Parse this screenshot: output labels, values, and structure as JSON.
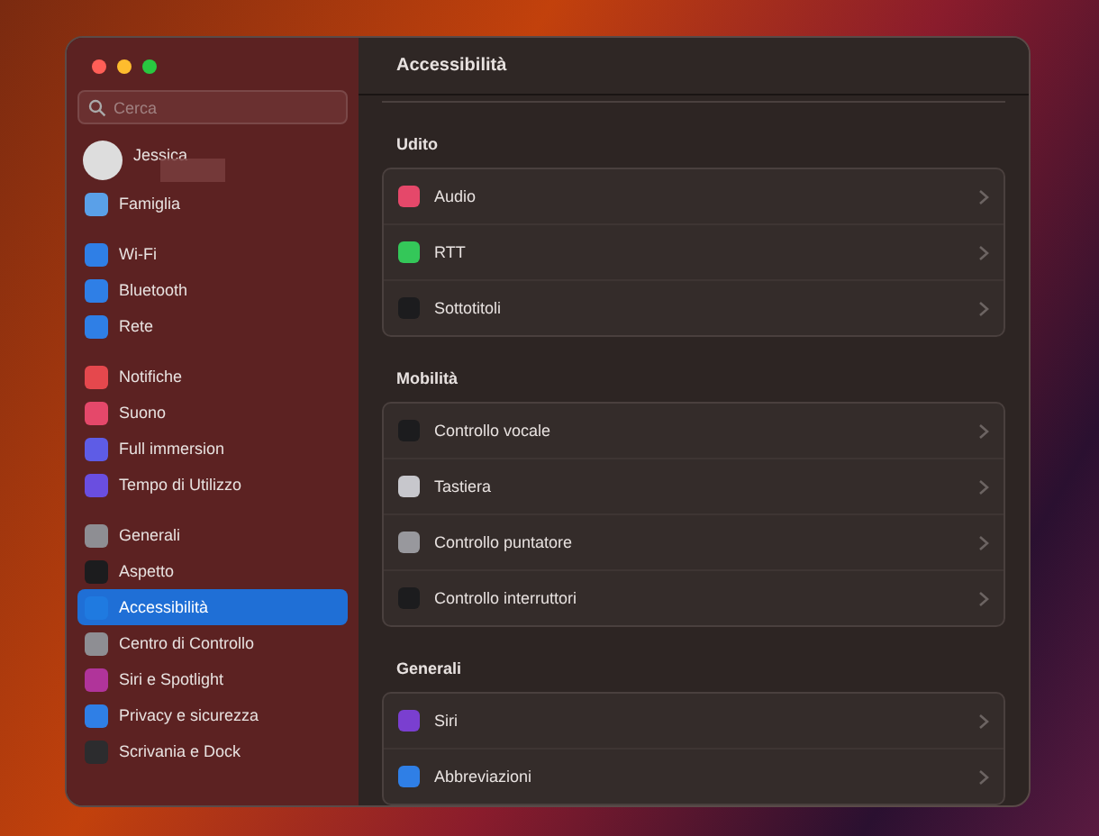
{
  "window": {
    "title": "Accessibilità"
  },
  "search": {
    "placeholder": "Cerca"
  },
  "profile": {
    "name": "Jessica"
  },
  "sidebar": {
    "groups": [
      {
        "items": [
          {
            "label": "Famiglia",
            "color": "#5aa0e8",
            "selected": false
          }
        ]
      },
      {
        "items": [
          {
            "label": "Wi-Fi",
            "color": "#2f7fe6",
            "selected": false
          },
          {
            "label": "Bluetooth",
            "color": "#2f7fe6",
            "selected": false
          },
          {
            "label": "Rete",
            "color": "#2f7fe6",
            "selected": false
          }
        ]
      },
      {
        "items": [
          {
            "label": "Notifiche",
            "color": "#e5484d",
            "selected": false
          },
          {
            "label": "Suono",
            "color": "#e5486a",
            "selected": false
          },
          {
            "label": "Full immersion",
            "color": "#5e5ce6",
            "selected": false
          },
          {
            "label": "Tempo di Utilizzo",
            "color": "#6a4ee0",
            "selected": false
          }
        ]
      },
      {
        "items": [
          {
            "label": "Generali",
            "color": "#8e8e93",
            "selected": false
          },
          {
            "label": "Aspetto",
            "color": "#1c1c1e",
            "selected": false
          },
          {
            "label": "Accessibilità",
            "color": "#1f7ae0",
            "selected": true
          },
          {
            "label": "Centro di Controllo",
            "color": "#8e8e93",
            "selected": false
          },
          {
            "label": "Siri e Spotlight",
            "color": "#b0349a",
            "selected": false
          },
          {
            "label": "Privacy e sicurezza",
            "color": "#2f7fe6",
            "selected": false
          },
          {
            "label": "Scrivania e Dock",
            "color": "#2c2c2e",
            "selected": false
          }
        ]
      }
    ]
  },
  "sections": [
    {
      "title": "Udito",
      "rows": [
        {
          "label": "Audio",
          "color": "#e5486a"
        },
        {
          "label": "RTT",
          "color": "#34c759"
        },
        {
          "label": "Sottotitoli",
          "color": "#1c1c1e"
        }
      ]
    },
    {
      "title": "Mobilità",
      "rows": [
        {
          "label": "Controllo vocale",
          "color": "#1c1c1e"
        },
        {
          "label": "Tastiera",
          "color": "#c7c7cc"
        },
        {
          "label": "Controllo puntatore",
          "color": "#98989d"
        },
        {
          "label": "Controllo interruttori",
          "color": "#1c1c1e"
        }
      ]
    },
    {
      "title": "Generali",
      "rows": [
        {
          "label": "Siri",
          "color": "#7a3fd0"
        },
        {
          "label": "Abbreviazioni",
          "color": "#2f7fe6"
        }
      ]
    }
  ]
}
